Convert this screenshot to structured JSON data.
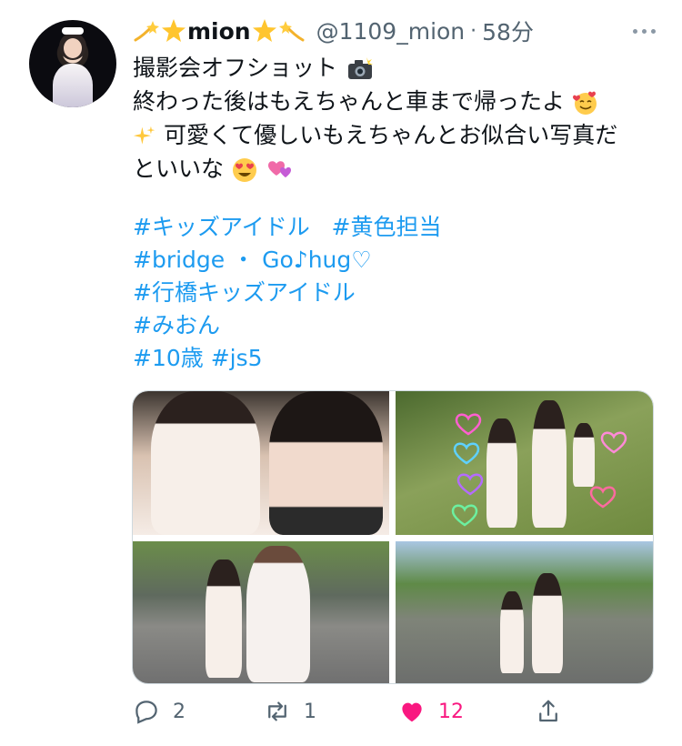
{
  "tweet": {
    "display_name": "mion",
    "handle": "@1109_mion",
    "separator": "·",
    "time": "58分",
    "text_lines": [
      "撮影会オフショット",
      "終わった後はもえちゃんと車まで帰ったよ",
      "可愛くて優しいもえちゃんとお似合い写真だ",
      "といいな"
    ],
    "hashtag_lines": [
      [
        "#キッズアイドル",
        "#黄色担当"
      ],
      [
        "#bridge",
        "・",
        "Go♪hug♡"
      ],
      [
        "#行橋キッズアイドル"
      ],
      [
        "#みおん"
      ],
      [
        "#10歳",
        "#js5"
      ]
    ],
    "icons": {
      "name_left": "shooting-star-emoji",
      "name_star": "star-emoji",
      "camera": "camera-flash-emoji",
      "smile": "smiling-face-with-hearts-emoji",
      "sparkles": "sparkles-emoji",
      "heart_eyes": "heart-eyes-emoji",
      "hearts": "two-hearts-emoji"
    }
  },
  "actions": {
    "reply_count": "2",
    "retweet_count": "1",
    "like_count": "12",
    "like_color": "#f91880",
    "link_color": "#1d9bf0"
  }
}
